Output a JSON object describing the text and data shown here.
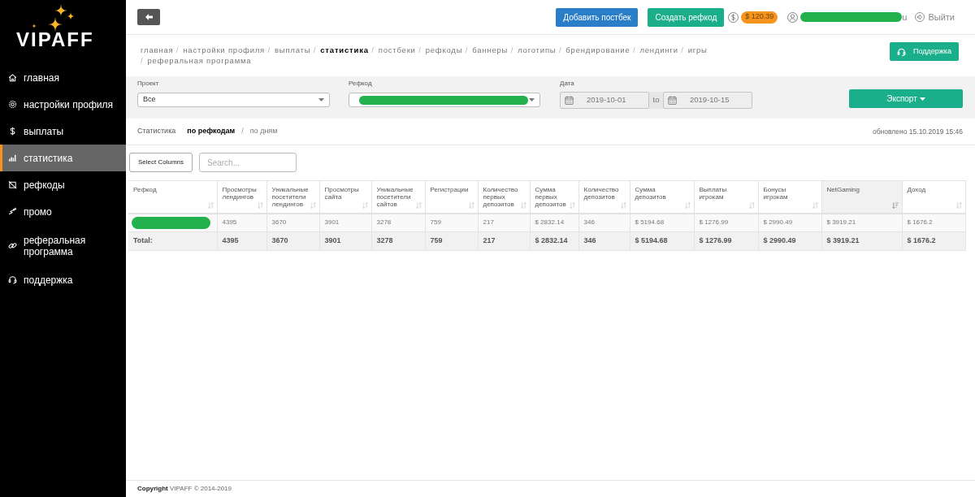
{
  "sidebar": {
    "logo": "VIPAFF",
    "items": [
      {
        "label": "главная",
        "selected": false
      },
      {
        "label": "настройки профиля",
        "selected": false
      },
      {
        "label": "выплаты",
        "selected": false
      },
      {
        "label": "статистика",
        "selected": true
      },
      {
        "label": "рефкоды",
        "selected": false
      },
      {
        "label": "промо",
        "selected": false
      },
      {
        "label": "реферальная программа",
        "selected": false
      },
      {
        "label": "поддержка",
        "selected": false
      }
    ]
  },
  "topbar": {
    "buttons": [
      {
        "label": "Добавить постбек",
        "kind": "primary"
      },
      {
        "label": "Создать рефкод",
        "kind": "success"
      }
    ],
    "balance": "$ 120.39",
    "user_email": "u",
    "logout": "Выйти"
  },
  "breadcrumbs": {
    "separator": "/",
    "items": [
      {
        "label": "главная",
        "selected": false
      },
      {
        "label": "настройки профиля",
        "selected": false
      },
      {
        "label": "выплаты",
        "selected": false
      },
      {
        "label": "статистика",
        "selected": true
      },
      {
        "label": "постбеки",
        "selected": false
      },
      {
        "label": "рефкоды",
        "selected": false
      },
      {
        "label": "баннеры",
        "selected": false
      },
      {
        "label": "логотипы",
        "selected": false
      },
      {
        "label": "брендирование",
        "selected": false
      },
      {
        "label": "лендинги",
        "selected": false
      },
      {
        "label": "игры",
        "selected": false
      },
      {
        "label": "реферальная программа",
        "selected": false
      }
    ]
  },
  "support_button": "Поддержка",
  "filters": {
    "project": {
      "label": "Проект",
      "value": "Все"
    },
    "refcode": {
      "label": "Рефкод"
    },
    "date": {
      "label": "Дата",
      "from": "2019-10-01",
      "separator": "to",
      "to": "2019-10-15"
    },
    "export_button": "Экспорт"
  },
  "stats": {
    "title": "Статистика",
    "separator": "/",
    "views": [
      {
        "label": "по рефкодам",
        "selected": true
      },
      {
        "label": "по дням",
        "selected": false
      }
    ],
    "updated": "обновлено 15.10.2019 15:46"
  },
  "table": {
    "select_columns_button": "Select Columns",
    "search": {
      "placeholder": "Search..."
    },
    "columns": [
      {
        "label": "Рефкод",
        "sorted": false
      },
      {
        "label": "Просмотры лендингов",
        "sorted": false
      },
      {
        "label": "Уникальные посетители лендингов",
        "sorted": false
      },
      {
        "label": "Просмотры сайта",
        "sorted": false
      },
      {
        "label": "Уникальные посетители сайтов",
        "sorted": false
      },
      {
        "label": "Регистрации",
        "sorted": false
      },
      {
        "label": "Количество первых депозитов",
        "sorted": false
      },
      {
        "label": "Сумма первых депозитов",
        "sorted": false
      },
      {
        "label": "Количество депозитов",
        "sorted": false
      },
      {
        "label": "Сумма депозитов",
        "sorted": false
      },
      {
        "label": "Выплаты игрокам",
        "sorted": false
      },
      {
        "label": "Бонусы игрокам",
        "sorted": false
      },
      {
        "label": "NetGaming",
        "sorted": true
      },
      {
        "label": "Доход",
        "sorted": false
      }
    ],
    "rows": [
      {
        "kind": "data",
        "values": [
          "4395",
          "3670",
          "3901",
          "3278",
          "759",
          "217",
          "$ 2832.14",
          "346",
          "$ 5194.68",
          "$ 1276.99",
          "$ 2990.49",
          "$ 3919.21",
          "$ 1676.2"
        ]
      },
      {
        "kind": "total",
        "label": "Total:",
        "values": [
          "4395",
          "3670",
          "3901",
          "3278",
          "759",
          "217",
          "$ 2832.14",
          "346",
          "$ 5194.68",
          "$ 1276.99",
          "$ 2990.49",
          "$ 3919.21",
          "$ 1676.2"
        ]
      }
    ]
  },
  "footer": "**Copyright** VIPAFF © 2014-2019"
}
